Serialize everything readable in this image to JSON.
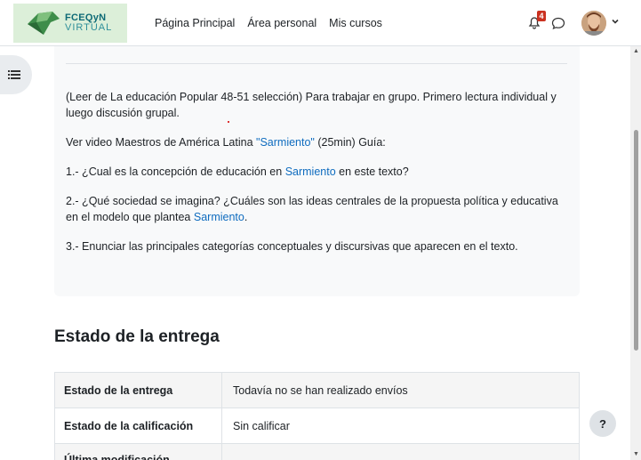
{
  "brand": {
    "line1": "FCEQyN",
    "line2": "VIRTUAL"
  },
  "nav": {
    "links": [
      "Página Principal",
      "Área personal",
      "Mis cursos"
    ],
    "notification_count": "4"
  },
  "intro": {
    "paragraph1": "(Leer de La educación Popular 48-51 selección) Para trabajar en grupo. Primero lectura individual y luego discusión grupal.",
    "video": {
      "before": "Ver video Maestros de América Latina ",
      "link": "\"Sarmiento\"",
      "after": " (25min) Guía:"
    },
    "q1": {
      "before": "1.- ¿Cual es la concepción de educación en ",
      "link": "Sarmiento",
      "after": " en este texto?"
    },
    "q2": {
      "before": "2.- ¿Qué sociedad se imagina? ¿Cuáles son las ideas centrales de la propuesta política y educativa en el modelo que plantea ",
      "link": "Sarmiento",
      "after": "."
    },
    "q3": "3.- Enunciar las principales categorías conceptuales y discursivas que aparecen en el texto."
  },
  "submission": {
    "heading": "Estado de la entrega",
    "rows": [
      {
        "label": "Estado de la entrega",
        "value": "Todavía no se han realizado envíos"
      },
      {
        "label": "Estado de la calificación",
        "value": "Sin calificar"
      },
      {
        "label": "Última modificación",
        "value": ""
      }
    ]
  },
  "help": "?",
  "icons": [
    "drawer-toggle-icon",
    "bell-icon",
    "chat-icon",
    "avatar",
    "chevron-down-icon",
    "help-icon"
  ],
  "colors": {
    "link": "#0f6cbf",
    "badge": "#ca3120",
    "brand_bg": "#dcefd9"
  }
}
